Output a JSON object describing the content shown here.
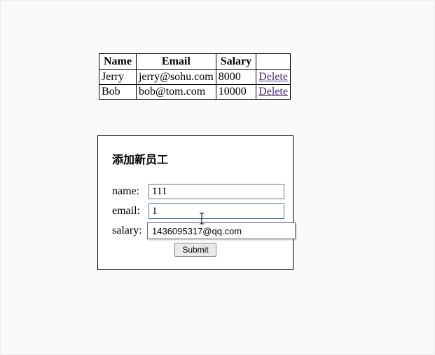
{
  "table": {
    "headers": [
      "Name",
      "Email",
      "Salary"
    ],
    "rows": [
      {
        "name": "Jerry",
        "email": "jerry@sohu.com",
        "salary": "8000",
        "delete_label": "Delete"
      },
      {
        "name": "Bob",
        "email": "bob@tom.com",
        "salary": "10000",
        "delete_label": "Delete"
      }
    ]
  },
  "form": {
    "title": "添加新员工",
    "name_label": "name: ",
    "email_label": "email: ",
    "salary_label": "salary: ",
    "name_value": "111",
    "email_value": "1",
    "salary_value": "",
    "submit_label": "Submit"
  },
  "autocomplete": {
    "suggestion": "1436095317@qq.com"
  }
}
